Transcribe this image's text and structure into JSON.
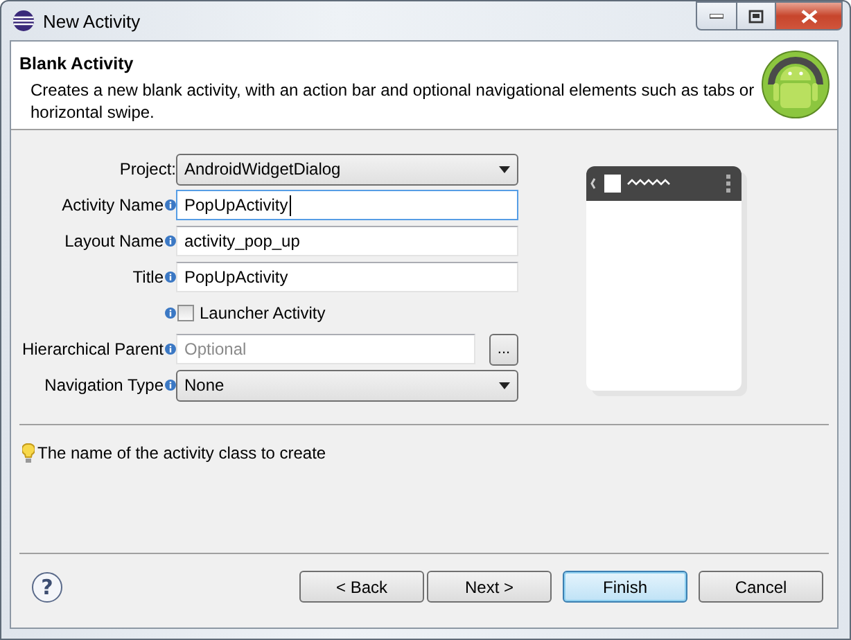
{
  "window": {
    "title": "New Activity"
  },
  "header": {
    "title": "Blank Activity",
    "description": "Creates a new blank activity, with an action bar and optional navigational elements such as tabs or horizontal swipe."
  },
  "fields": [
    {
      "kind": "dropdown",
      "label": "Project:",
      "value": "AndroidWidgetDialog",
      "info": false
    },
    {
      "kind": "text",
      "label": "Activity Name",
      "value": "PopUpActivity",
      "info": true,
      "focused": true
    },
    {
      "kind": "text",
      "label": "Layout Name",
      "value": "activity_pop_up",
      "info": true,
      "focused": false
    },
    {
      "kind": "text",
      "label": "Title",
      "value": "PopUpActivity",
      "info": true,
      "focused": false
    },
    {
      "kind": "checkbox",
      "label": "Launcher Activity",
      "info": true,
      "checked": false
    },
    {
      "kind": "browse",
      "label": "Hierarchical Parent",
      "placeholder": "Optional",
      "info": true,
      "button": "..."
    },
    {
      "kind": "dropdown",
      "label": "Navigation Type",
      "value": "None",
      "info": true
    }
  ],
  "hint": "The name of the activity class to create",
  "help_button": "?",
  "buttons": [
    {
      "label": "< Back",
      "default": false
    },
    {
      "label": "Next >",
      "default": false
    },
    {
      "label": "Finish",
      "default": true
    },
    {
      "label": "Cancel",
      "default": false
    }
  ]
}
